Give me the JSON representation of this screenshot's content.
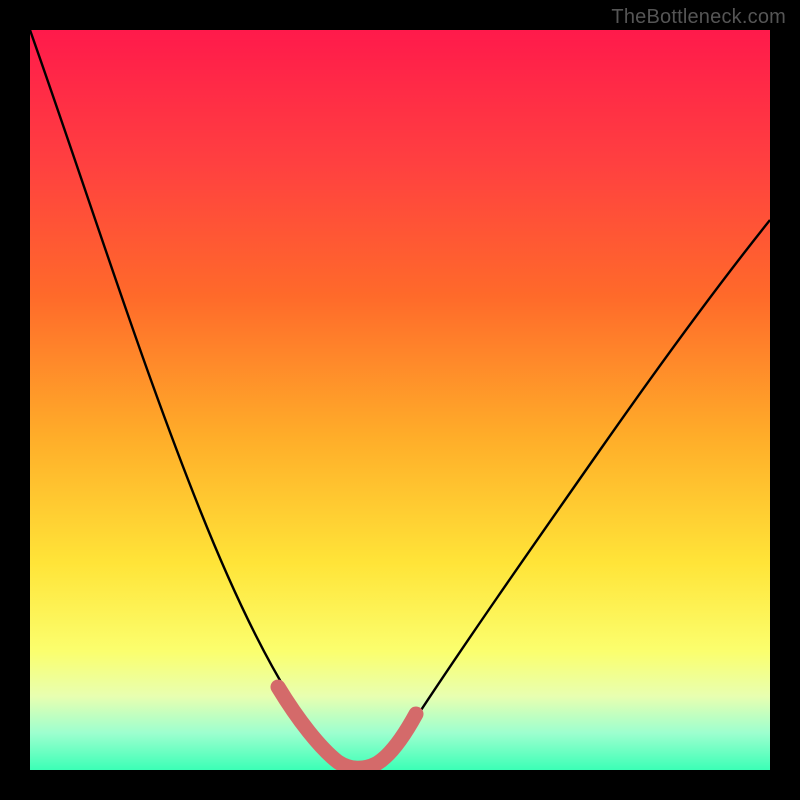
{
  "watermark": {
    "text": "TheBottleneck.com"
  },
  "chart_data": {
    "type": "line",
    "title": "",
    "xlabel": "",
    "ylabel": "",
    "xlim": [
      0,
      100
    ],
    "ylim": [
      0,
      100
    ],
    "series": [
      {
        "name": "curve",
        "stroke": "#000000",
        "x": [
          0,
          5,
          10,
          15,
          20,
          25,
          30,
          33,
          36,
          39,
          41,
          43,
          45,
          47,
          50,
          55,
          60,
          65,
          70,
          75,
          80,
          85,
          90,
          95,
          100
        ],
        "bottleneck_pct": [
          100,
          88,
          76,
          64,
          52,
          40,
          28,
          19,
          12,
          6,
          2,
          0,
          0,
          2,
          6,
          14,
          22,
          30,
          37,
          44,
          50,
          56,
          62,
          67,
          72
        ]
      }
    ],
    "highlight": {
      "stroke": "#d46a6a",
      "x": [
        33,
        36,
        39,
        41,
        43,
        45,
        47,
        50
      ],
      "bottleneck_pct": [
        19,
        12,
        6,
        2,
        0,
        0,
        2,
        6
      ]
    },
    "gradient_bands": [
      {
        "color": "#ff1a4b",
        "pct": 100
      },
      {
        "color": "#ffe438",
        "pct": 50
      },
      {
        "color": "#3bffb6",
        "pct": 0
      }
    ]
  }
}
